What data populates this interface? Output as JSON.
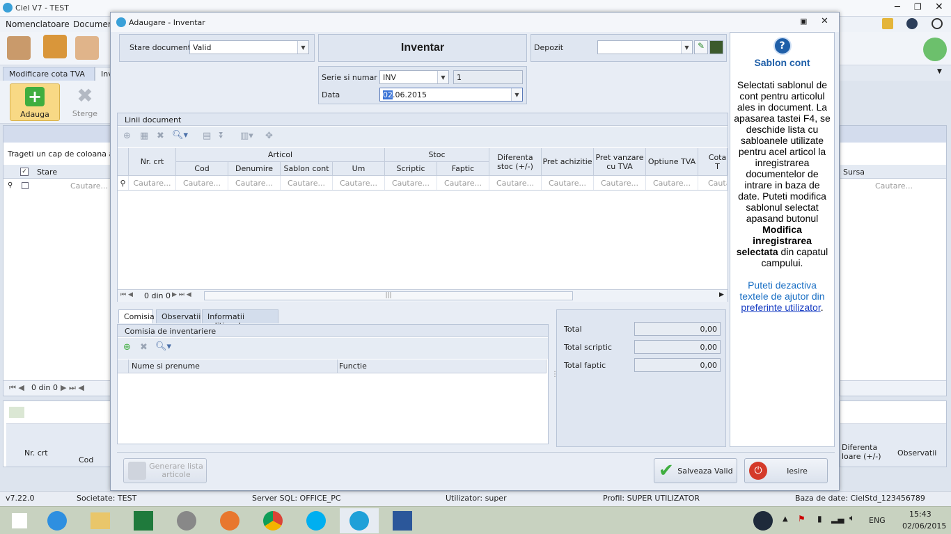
{
  "app": {
    "title": "Ciel V7 - TEST",
    "menu": [
      "Nomenclatoare",
      "Documen"
    ],
    "tabs": [
      "Modificare cota TVA",
      "Inv"
    ],
    "ribbon": {
      "add": "Adauga",
      "delete": "Sterge"
    },
    "left_grid": {
      "hint": "Trageti un cap de coloana aici p",
      "col": "Stare",
      "search": "Cautare...",
      "nav": "0 din 0"
    },
    "right_grid": {
      "col": "Sursa",
      "search": "Cautare..."
    },
    "bottom_grid": {
      "nr": "Nr. crt",
      "cod": "Cod",
      "diff": "Diferenta\nloare (+/-)",
      "obs": "Observatii"
    }
  },
  "status": {
    "version": "v7.22.0",
    "company": "Societate: TEST",
    "server": "Server SQL: OFFICE_PC",
    "user": "Utilizator: super",
    "profile": "Profil: SUPER UTILIZATOR",
    "db": "Baza de date: CielStd_123456789"
  },
  "taskbar": {
    "lang": "ENG",
    "time": "15:43",
    "date": "02/06/2015"
  },
  "dialog": {
    "title": "Adaugare - Inventar",
    "heading": "Inventar",
    "stare_label": "Stare document",
    "stare_value": "Valid",
    "depozit_label": "Depozit",
    "depozit_value": "",
    "serie_label": "Serie si numar",
    "serie_value": "INV",
    "numar_value": "1",
    "data_label": "Data",
    "data_sel": "02",
    "data_rest": ".06.2015",
    "lines_title": "Linii document",
    "columns": {
      "nr": "Nr. crt",
      "articol": "Articol",
      "cod": "Cod",
      "denumire": "Denumire",
      "sablon": "Sablon cont",
      "um": "Um",
      "stoc": "Stoc",
      "scriptic": "Scriptic",
      "faptic": "Faptic",
      "diferenta": "Diferenta stoc (+/-)",
      "pret_achizitie": "Pret achizitie",
      "pret_vanzare": "Pret vanzare cu TVA",
      "optiune": "Optiune TVA",
      "cota": "Cota T"
    },
    "search": "Cautare...",
    "nav": "0 din 0",
    "tabs": [
      "Comisia",
      "Observatii",
      "Informatii aditionale"
    ],
    "comisia_title": "Comisia de inventariere",
    "comisia_cols": {
      "nume": "Nume si prenume",
      "functie": "Functie"
    },
    "totals": [
      {
        "label": "Total",
        "value": "0,00"
      },
      {
        "label": "Total scriptic",
        "value": "0,00"
      },
      {
        "label": "Total faptic",
        "value": "0,00"
      }
    ],
    "btn_generate": "Generare lista articole",
    "btn_save": "Salveaza Valid",
    "btn_exit": "Iesire",
    "help": {
      "title": "Sablon cont",
      "text1": "Selectati sablonul de cont pentru articolul ales in document. La apasarea tastei F4, se deschide lista cu sabloanele utilizate pentru acel articol la inregistrarea documentelor de intrare in baza de date. Puteti modifica sablonul selectat apasand butonul",
      "bold": "Modifica inregistrarea selectata",
      "text2": "din capatul campului.",
      "text3": "Puteti dezactiva textele de ajutor din",
      "link": "preferinte utilizator",
      "dot": "."
    }
  },
  "colors": {
    "accent": "#1a6fc4",
    "help_title": "#1f5fa8",
    "window_bg": "#e8edf5"
  }
}
